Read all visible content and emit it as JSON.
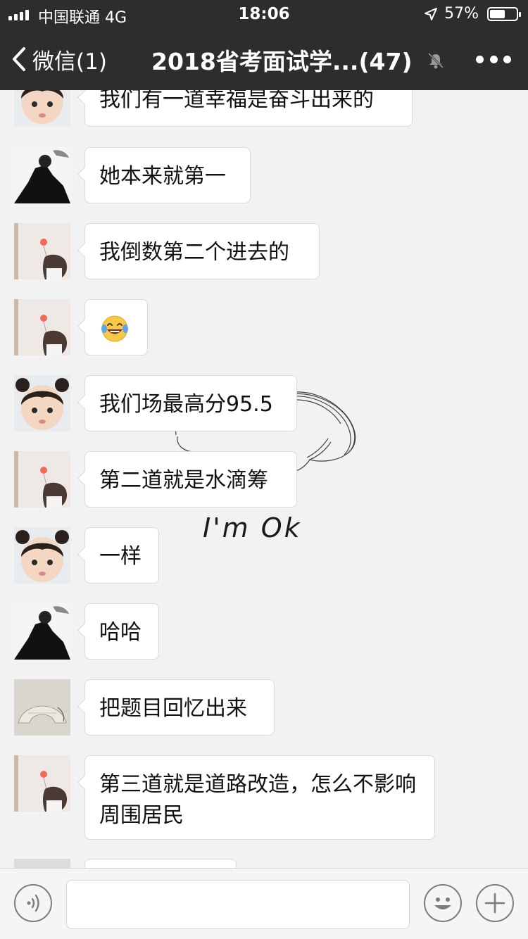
{
  "status_bar": {
    "carrier": "中国联通  4G",
    "time": "18:06",
    "battery_percent": "57%",
    "battery_level": 0.57
  },
  "nav": {
    "back_label": "微信(1)",
    "title": "2018省考面试学...(47)",
    "icons": [
      "chevron-left-icon",
      "mute-icon",
      "more-icon"
    ]
  },
  "background_art": {
    "caption": "I'm  Ok"
  },
  "messages": [
    {
      "avatar": "child-avatar",
      "text": "我们有一道幸福是奋斗出来的"
    },
    {
      "avatar": "bw-man-avatar",
      "text": "她本来就第一"
    },
    {
      "avatar": "girl-balloon-avatar",
      "text": "我倒数第二个进去的"
    },
    {
      "avatar": "girl-balloon-avatar",
      "emoji": "laughing-tears-emoji"
    },
    {
      "avatar": "child-avatar",
      "text": "我们场最高分95.5"
    },
    {
      "avatar": "girl-balloon-avatar",
      "text": "第二道就是水滴筹"
    },
    {
      "avatar": "child-avatar",
      "text": "一样"
    },
    {
      "avatar": "bw-man-avatar",
      "text": "哈哈"
    },
    {
      "avatar": "fan-painting-avatar",
      "text": "把题目回忆出来"
    },
    {
      "avatar": "girl-balloon-avatar",
      "text": "第三道就是道路改造，怎么不影响周围居民"
    }
  ],
  "input_bar": {
    "icons": [
      "voice-icon",
      "emoji-icon",
      "plus-icon"
    ]
  },
  "colors": {
    "nav_background": "#2d2d2d",
    "chat_background": "#f2f2f2",
    "bubble": "#ffffff"
  }
}
